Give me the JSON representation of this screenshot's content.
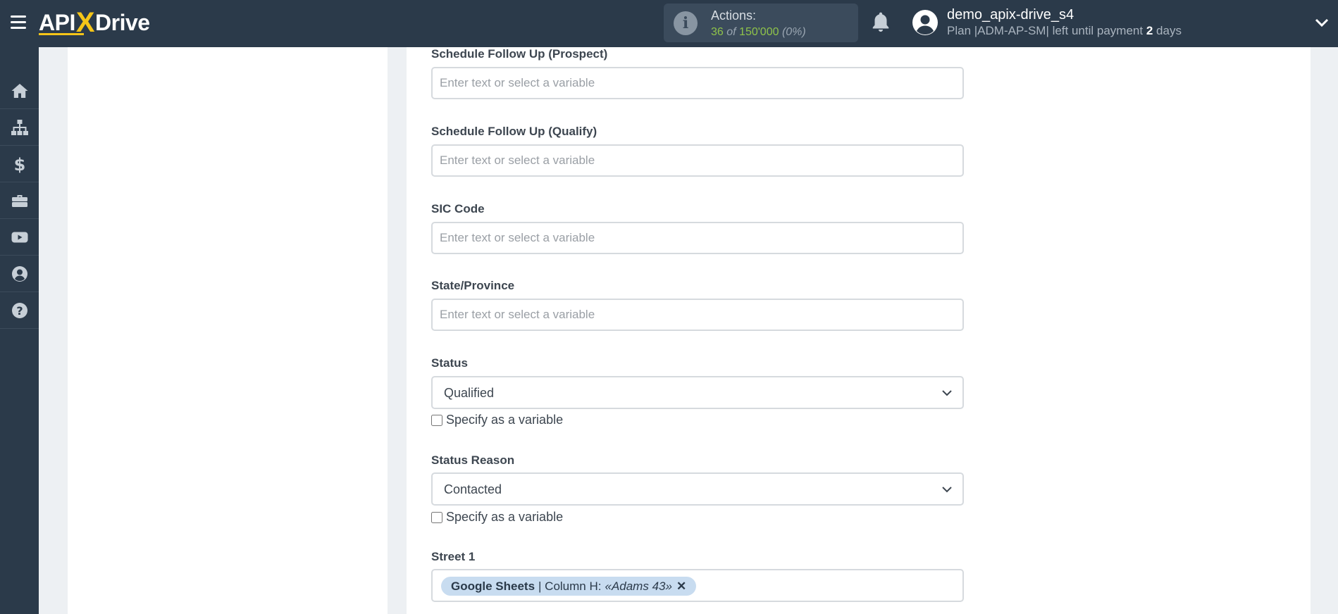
{
  "app": {
    "logo_api": "API",
    "logo_x": "X",
    "logo_drive": "Drive"
  },
  "header": {
    "actions_title": "Actions:",
    "actions_used": "36",
    "actions_of": "of",
    "actions_total": "150'000",
    "actions_percent": "(0%)",
    "user_name": "demo_apix-drive_s4",
    "plan_text": "Plan |ADM-AP-SM| left until payment",
    "days_count": "2",
    "days_label": "days"
  },
  "sidebar": {
    "items": [
      {
        "icon": "home-icon"
      },
      {
        "icon": "sitemap-icon"
      },
      {
        "icon": "dollar-icon"
      },
      {
        "icon": "briefcase-icon"
      },
      {
        "icon": "youtube-icon"
      },
      {
        "icon": "user-circle-icon"
      },
      {
        "icon": "help-icon"
      }
    ]
  },
  "form": {
    "placeholder": "Enter text or select a variable",
    "schedule_prospect_label": "Schedule Follow Up (Prospect)",
    "schedule_qualify_label": "Schedule Follow Up (Qualify)",
    "sic_code_label": "SIC Code",
    "state_label": "State/Province",
    "status_label": "Status",
    "status_value": "Qualified",
    "status_reason_label": "Status Reason",
    "status_reason_value": "Contacted",
    "specify_variable": "Specify as a variable",
    "street1_label": "Street 1",
    "street1_tag_source": "Google Sheets",
    "street1_tag_column": "| Column H:",
    "street1_tag_value": "«Adams 43»",
    "street1_tag_remove": "✕"
  },
  "colors": {
    "topbar": "#2b3a4a",
    "accent_yellow": "#f5c518",
    "actions_green": "#8fc34a",
    "tag_bg": "#c8dcf0"
  }
}
